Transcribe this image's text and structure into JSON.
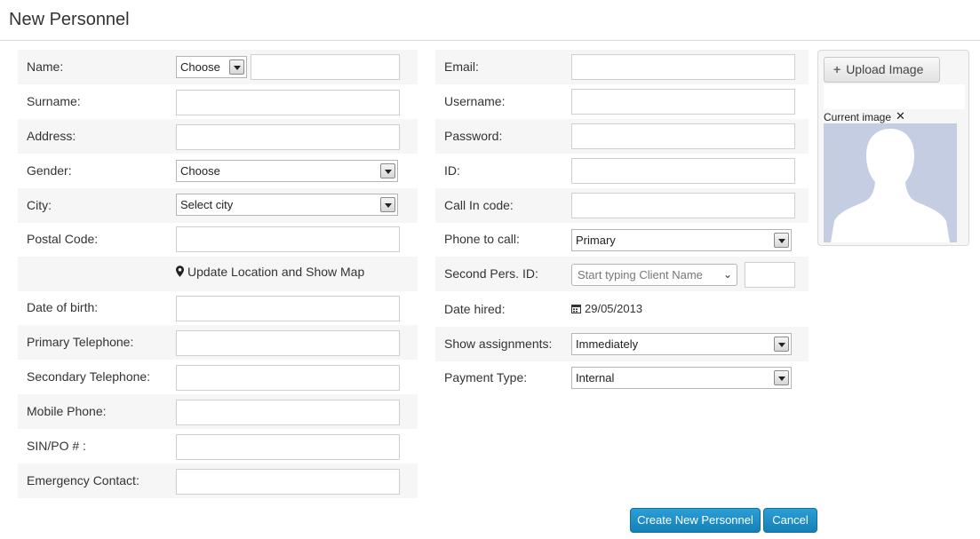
{
  "page": {
    "title": "New Personnel"
  },
  "left_form": {
    "name_label": "Name:",
    "name_prefix_select": "Choose",
    "surname_label": "Surname:",
    "address_label": "Address:",
    "gender_label": "Gender:",
    "gender_select": "Choose",
    "city_label": "City:",
    "city_select": "Select city",
    "postal_label": "Postal Code:",
    "map_link": "Update Location and Show Map",
    "dob_label": "Date of birth:",
    "primary_tel_label": "Primary Telephone:",
    "secondary_tel_label": "Secondary Telephone:",
    "mobile_label": "Mobile Phone:",
    "sin_label": "SIN/PO # :",
    "emergency_label": "Emergency Contact:"
  },
  "right_form": {
    "email_label": "Email:",
    "username_label": "Username:",
    "password_label": "Password:",
    "id_label": "ID:",
    "callin_label": "Call In code:",
    "phone_label": "Phone to call:",
    "phone_select": "Primary",
    "second_id_label": "Second Pers. ID:",
    "second_id_placeholder": "Start typing Client Name",
    "date_hired_label": "Date hired:",
    "date_hired_value": "29/05/2013",
    "assign_label": "Show assignments:",
    "assign_select": "Immediately",
    "payment_label": "Payment Type:",
    "payment_select": "Internal"
  },
  "image_panel": {
    "upload_label": "Upload Image",
    "current_label": "Current image",
    "remove_glyph": "✕"
  },
  "actions": {
    "create_label": "Create New Personnel",
    "cancel_label": "Cancel"
  },
  "colors": {
    "primary_button": "#1a8cc8",
    "row_shade": "#f6f6f6",
    "avatar_bg": "#c5cde3"
  }
}
